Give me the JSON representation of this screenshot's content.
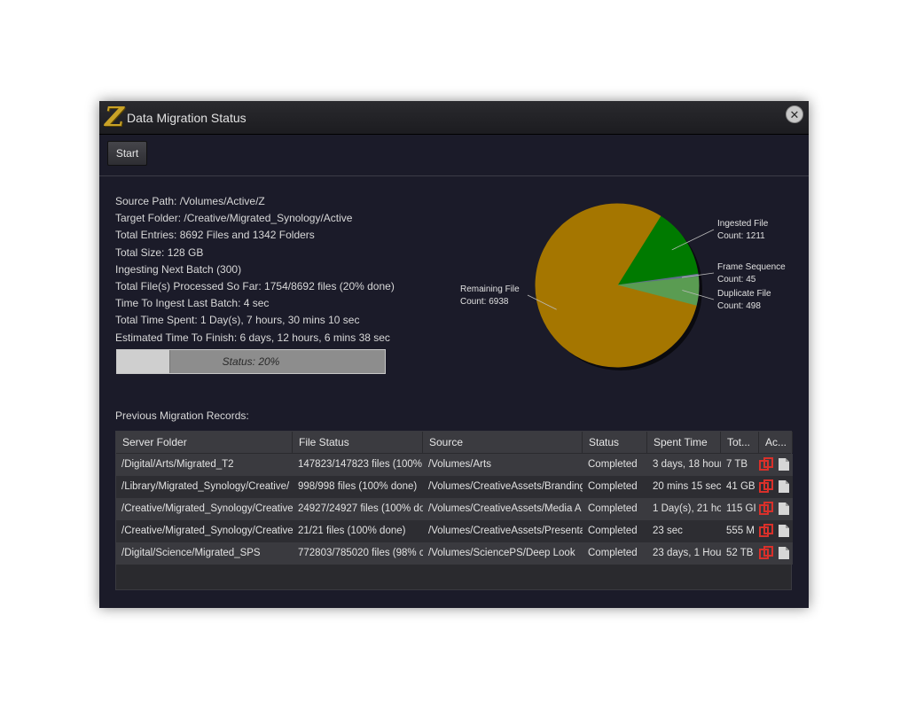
{
  "window": {
    "title": "Data Migration Status",
    "logo": "Z",
    "close_icon": "close-icon"
  },
  "toolbar": {
    "start_label": "Start"
  },
  "info": [
    "Source Path: /Volumes/Active/Z",
    "Target Folder:  /Creative/Migrated_Synology/Active",
    "Total Entries: 8692 Files and 1342 Folders",
    "Total Size: 128 GB",
    "Ingesting Next Batch (300)",
    "Total File(s) Processed So Far: 1754/8692 files (20% done)",
    "Time To Ingest Last Batch: 4 sec",
    "Total Time Spent: 1 Day(s), 7 hours, 30 mins 10 sec",
    "Estimated Time To Finish: 6 days, 12 hours, 6 mins 38 sec"
  ],
  "progress": {
    "label": "Status: 20%",
    "percent": 20
  },
  "chart_data": {
    "type": "pie",
    "slices": [
      {
        "name": "Ingested File",
        "count_label": "Count: 1211",
        "value": 1211,
        "color": "#007a00"
      },
      {
        "name": "Frame Sequence",
        "count_label": "Count: 45",
        "value": 45,
        "color": "#5f6f8a"
      },
      {
        "name": "Duplicate File",
        "count_label": "Count: 498",
        "value": 498,
        "color": "#5a9c52"
      },
      {
        "name": "Remaining File",
        "count_label": "Count: 6938",
        "value": 6938,
        "color": "#a57600"
      }
    ]
  },
  "records": {
    "label": "Previous Migration Records:",
    "columns": [
      "Server Folder",
      "File Status",
      "Source",
      "Status",
      "Spent Time",
      "Tot...",
      "Ac..."
    ],
    "rows": [
      [
        "/Digital/Arts/Migrated_T2",
        "147823/147823 files (100%",
        "/Volumes/Arts",
        "Completed",
        "3 days, 18 hour",
        "7 TB"
      ],
      [
        "/Library/Migrated_Synology/Creative/",
        "998/998 files (100% done)",
        "/Volumes/CreativeAssets/Branding",
        "Completed",
        "20 mins 15 sec",
        "41 GB"
      ],
      [
        "/Creative/Migrated_Synology/Creative",
        "24927/24927 files (100% do",
        "/Volumes/CreativeAssets/Media A",
        "Completed",
        "1 Day(s), 21 ho",
        "115 GI"
      ],
      [
        "/Creative/Migrated_Synology/Creative",
        "21/21 files (100% done)",
        "/Volumes/CreativeAssets/Presenta",
        "Completed",
        "23 sec",
        "555 M"
      ],
      [
        "/Digital/Science/Migrated_SPS",
        "772803/785020 files (98% c",
        "/Volumes/SciencePS/Deep Look",
        "Completed",
        "23 days, 1 Hou",
        "52 TB"
      ]
    ]
  },
  "colors": {
    "dialog_bg": "#1b1b29",
    "accent_red": "#d9302a"
  }
}
